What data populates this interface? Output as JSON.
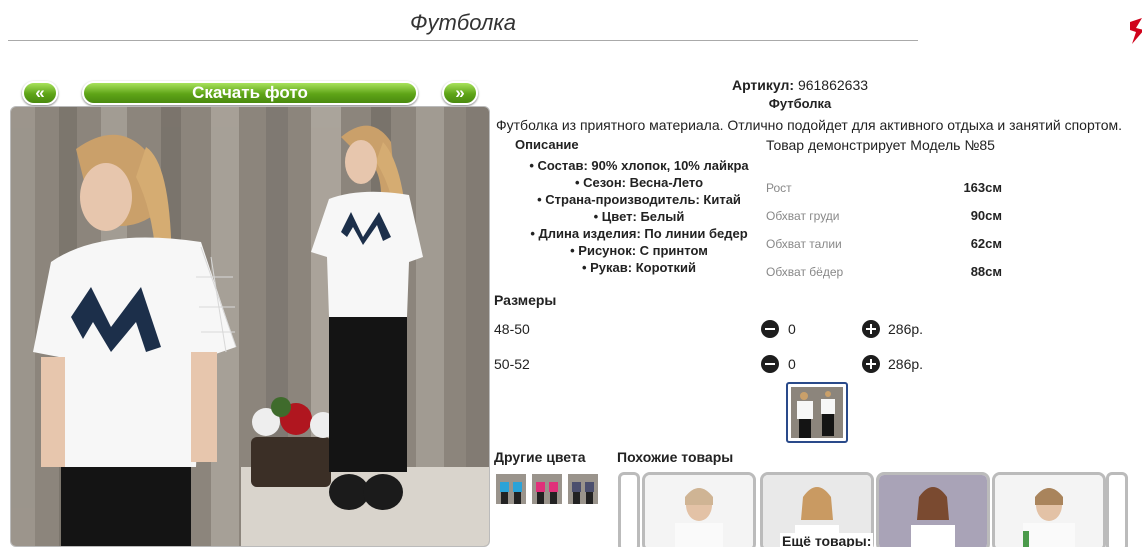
{
  "header": {
    "title": "Футболка"
  },
  "photo_nav": {
    "prev_label": "«",
    "download_label": "Скачать фото",
    "next_label": "»"
  },
  "product": {
    "article_label": "Артикул:",
    "article_value": "961862633",
    "name": "Футболка",
    "description": "Футболка из приятного материала. Отлично подойдет для активного отдыха и занятий спортом."
  },
  "attributes": {
    "title": "Описание",
    "items": [
      "Состав: 90% хлопок, 10% лайкра",
      "Сезон: Весна-Лето",
      "Страна-производитель: Китай",
      "Цвет: Белый",
      "Длина изделия: По линии бедер",
      "Рисунок: С принтом",
      "Рукав: Короткий"
    ]
  },
  "model": {
    "title": "Товар демонстрирует Модель №85",
    "measures": [
      {
        "label": "Рост",
        "value": "163см"
      },
      {
        "label": "Обхват груди",
        "value": "90см"
      },
      {
        "label": "Обхват талии",
        "value": "62см"
      },
      {
        "label": "Обхват бёдер",
        "value": "88см"
      }
    ]
  },
  "sizes": {
    "title": "Размеры",
    "rows": [
      {
        "size": "48-50",
        "qty": "0",
        "price": "286р."
      },
      {
        "size": "50-52",
        "qty": "0",
        "price": "286р."
      }
    ]
  },
  "other_colors": {
    "title": "Другие цвета"
  },
  "similar": {
    "title": "Похожие товары",
    "more_label": "Ещё товары:"
  },
  "colors": {
    "accent_green": "#5ea417",
    "frame_blue": "#2a4a8a",
    "wall_gray": "#8c857c"
  }
}
